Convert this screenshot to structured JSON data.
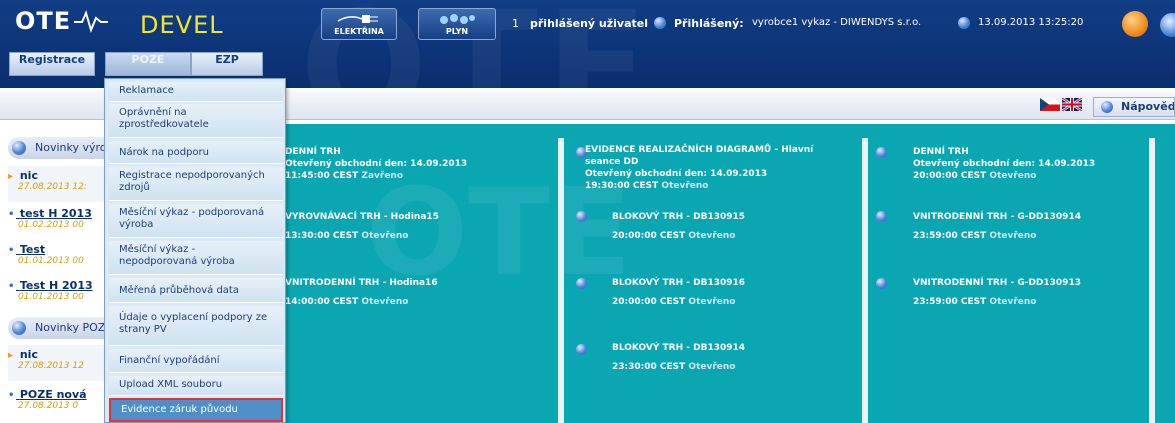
{
  "header": {
    "logo_text": "OTE",
    "env_label": "DEVEL",
    "product_buttons": [
      {
        "label": "ELEKTŘINA",
        "icon": "plug-icon"
      },
      {
        "label": "PLYN",
        "icon": "flame-icon"
      }
    ],
    "users_count": "1",
    "users_label": "přihlášený uživatel",
    "logged_label": "Přihlášený:",
    "logged_user": "vyrobce1 vykaz - DIWENDYS s.r.o.",
    "datetime": "13.09.2013 13:25:20"
  },
  "tabs": [
    {
      "label": "Registrace"
    },
    {
      "label": "POZE"
    },
    {
      "label": "EZP"
    }
  ],
  "toolbar": {
    "help_label": "Nápověda",
    "flags": [
      "cz-flag-icon",
      "uk-flag-icon"
    ]
  },
  "sidebar": {
    "sections": [
      {
        "label": "Novinky výrobci"
      },
      {
        "label": "Novinky POZE"
      }
    ],
    "news_a": [
      {
        "title": "nic",
        "date": "27.08.2013 12:",
        "marker": "arrow"
      },
      {
        "title": "test H 2013",
        "date": "01.02.2013 00",
        "marker": "bullet"
      },
      {
        "title": "Test",
        "date": "01.01.2013 00",
        "marker": "bullet"
      },
      {
        "title": "Test H 2013",
        "date": "01.01.2013 00",
        "marker": "bullet"
      }
    ],
    "news_b": [
      {
        "title": "nic",
        "date": "27.08.2013 12",
        "marker": "arrow"
      },
      {
        "title": "POZE nová",
        "date": "27.08.2013 0",
        "marker": "bullet"
      }
    ]
  },
  "market": {
    "col1": [
      {
        "title": "DENNÍ TRH",
        "line2": "Otevřený obchodní den: 14.09.2013",
        "time": "11:45:00 CEST",
        "status": "Zavřeno"
      },
      {
        "title": "VYROVNÁVACÍ TRH - Hodina15",
        "time": "13:30:00 CEST",
        "status": "Otevřeno"
      },
      {
        "title": "VNITRODENNÍ TRH - Hodina16",
        "time": "14:00:00 CEST",
        "status": "Otevřeno"
      }
    ],
    "col2": [
      {
        "title": "EVIDENCE REALIZAČNÍCH DIAGRAMŮ - Hlavní",
        "title2": "seance DD",
        "line2": "Otevřený obchodní den: 14.09.2013",
        "time": "19:30:00 CEST",
        "status": "Otevřeno"
      },
      {
        "title": "BLOKOVÝ TRH - DB130915",
        "time": "20:00:00 CEST",
        "status": "Otevřeno"
      },
      {
        "title": "BLOKOVÝ TRH - DB130916",
        "time": "20:00:00 CEST",
        "status": "Otevřeno"
      },
      {
        "title": "BLOKOVÝ TRH - DB130914",
        "time": "23:30:00 CEST",
        "status": "Otevřeno"
      }
    ],
    "col3": [
      {
        "title": "DENNÍ TRH",
        "line2": "Otevřený obchodní den: 14.09.2013",
        "time": "20:00:00 CEST",
        "status": "Otevřeno"
      },
      {
        "title": "VNITRODENNÍ TRH - G-DD130914",
        "time": "23:59:00 CEST",
        "status": "Otevřeno"
      },
      {
        "title": "VNITRODENNÍ TRH - G-DD130913",
        "time": "23:59:00 CEST",
        "status": "Otevřeno"
      }
    ]
  },
  "poze_menu": [
    {
      "label": "Reklamace"
    },
    {
      "label": "Oprávnění na zprostředkovatele"
    },
    {
      "label": "Nárok na podporu"
    },
    {
      "label": "Registrace nepodporovaných zdrojů"
    },
    {
      "label": "Měsíční výkaz - podporovaná výroba"
    },
    {
      "label": "Měsíční výkaz - nepodporovaná výroba"
    },
    {
      "label": "Měřená průběhová data"
    },
    {
      "label": "Údaje o vyplacení podpory ze strany PV"
    },
    {
      "label": "Finanční vypořádání"
    },
    {
      "label": "Upload XML souboru"
    },
    {
      "label": "Evidence záruk původu"
    }
  ],
  "colors": {
    "header": "#0c3478",
    "board": "#0aa6b2",
    "env": "#f5e52b",
    "highlight": "#e53131"
  }
}
